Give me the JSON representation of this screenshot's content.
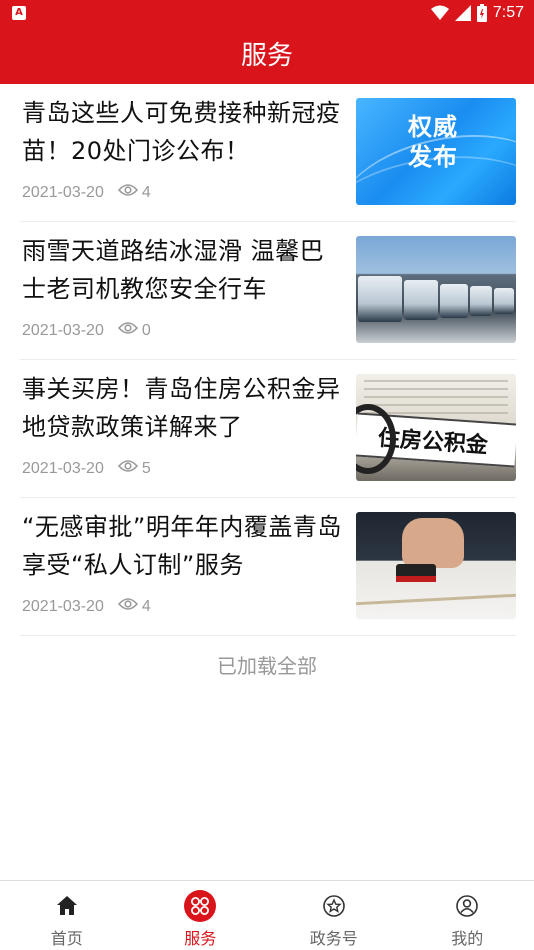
{
  "status_bar": {
    "time": "7:57",
    "app_icon_letter": "A"
  },
  "header": {
    "title": "服务"
  },
  "articles": [
    {
      "title": "青岛这些人可免费接种新冠疫苗！20处门诊公布！",
      "date": "2021-03-20",
      "views": "4",
      "thumb_text": "权威\n发布",
      "thumb_line1": "权威",
      "thumb_line2": "发布"
    },
    {
      "title": "雨雪天道路结冰湿滑 温馨巴士老司机教您安全行车",
      "date": "2021-03-20",
      "views": "0"
    },
    {
      "title": "事关买房！青岛住房公积金异地贷款政策详解来了",
      "date": "2021-03-20",
      "views": "5",
      "thumb_text": "住房公积金"
    },
    {
      "title": "“无感审批”明年年内覆盖青岛 享受“私人订制”服务",
      "date": "2021-03-20",
      "views": "4"
    }
  ],
  "list_footer": "已加载全部",
  "tabbar": {
    "tabs": [
      {
        "label": "首页",
        "icon": "home-icon",
        "active": false
      },
      {
        "label": "服务",
        "icon": "services-grid-icon",
        "active": true
      },
      {
        "label": "政务号",
        "icon": "government-badge-icon",
        "active": false
      },
      {
        "label": "我的",
        "icon": "profile-icon",
        "active": false
      }
    ]
  },
  "colors": {
    "brand_red": "#d9151b",
    "meta_gray": "#999999"
  }
}
